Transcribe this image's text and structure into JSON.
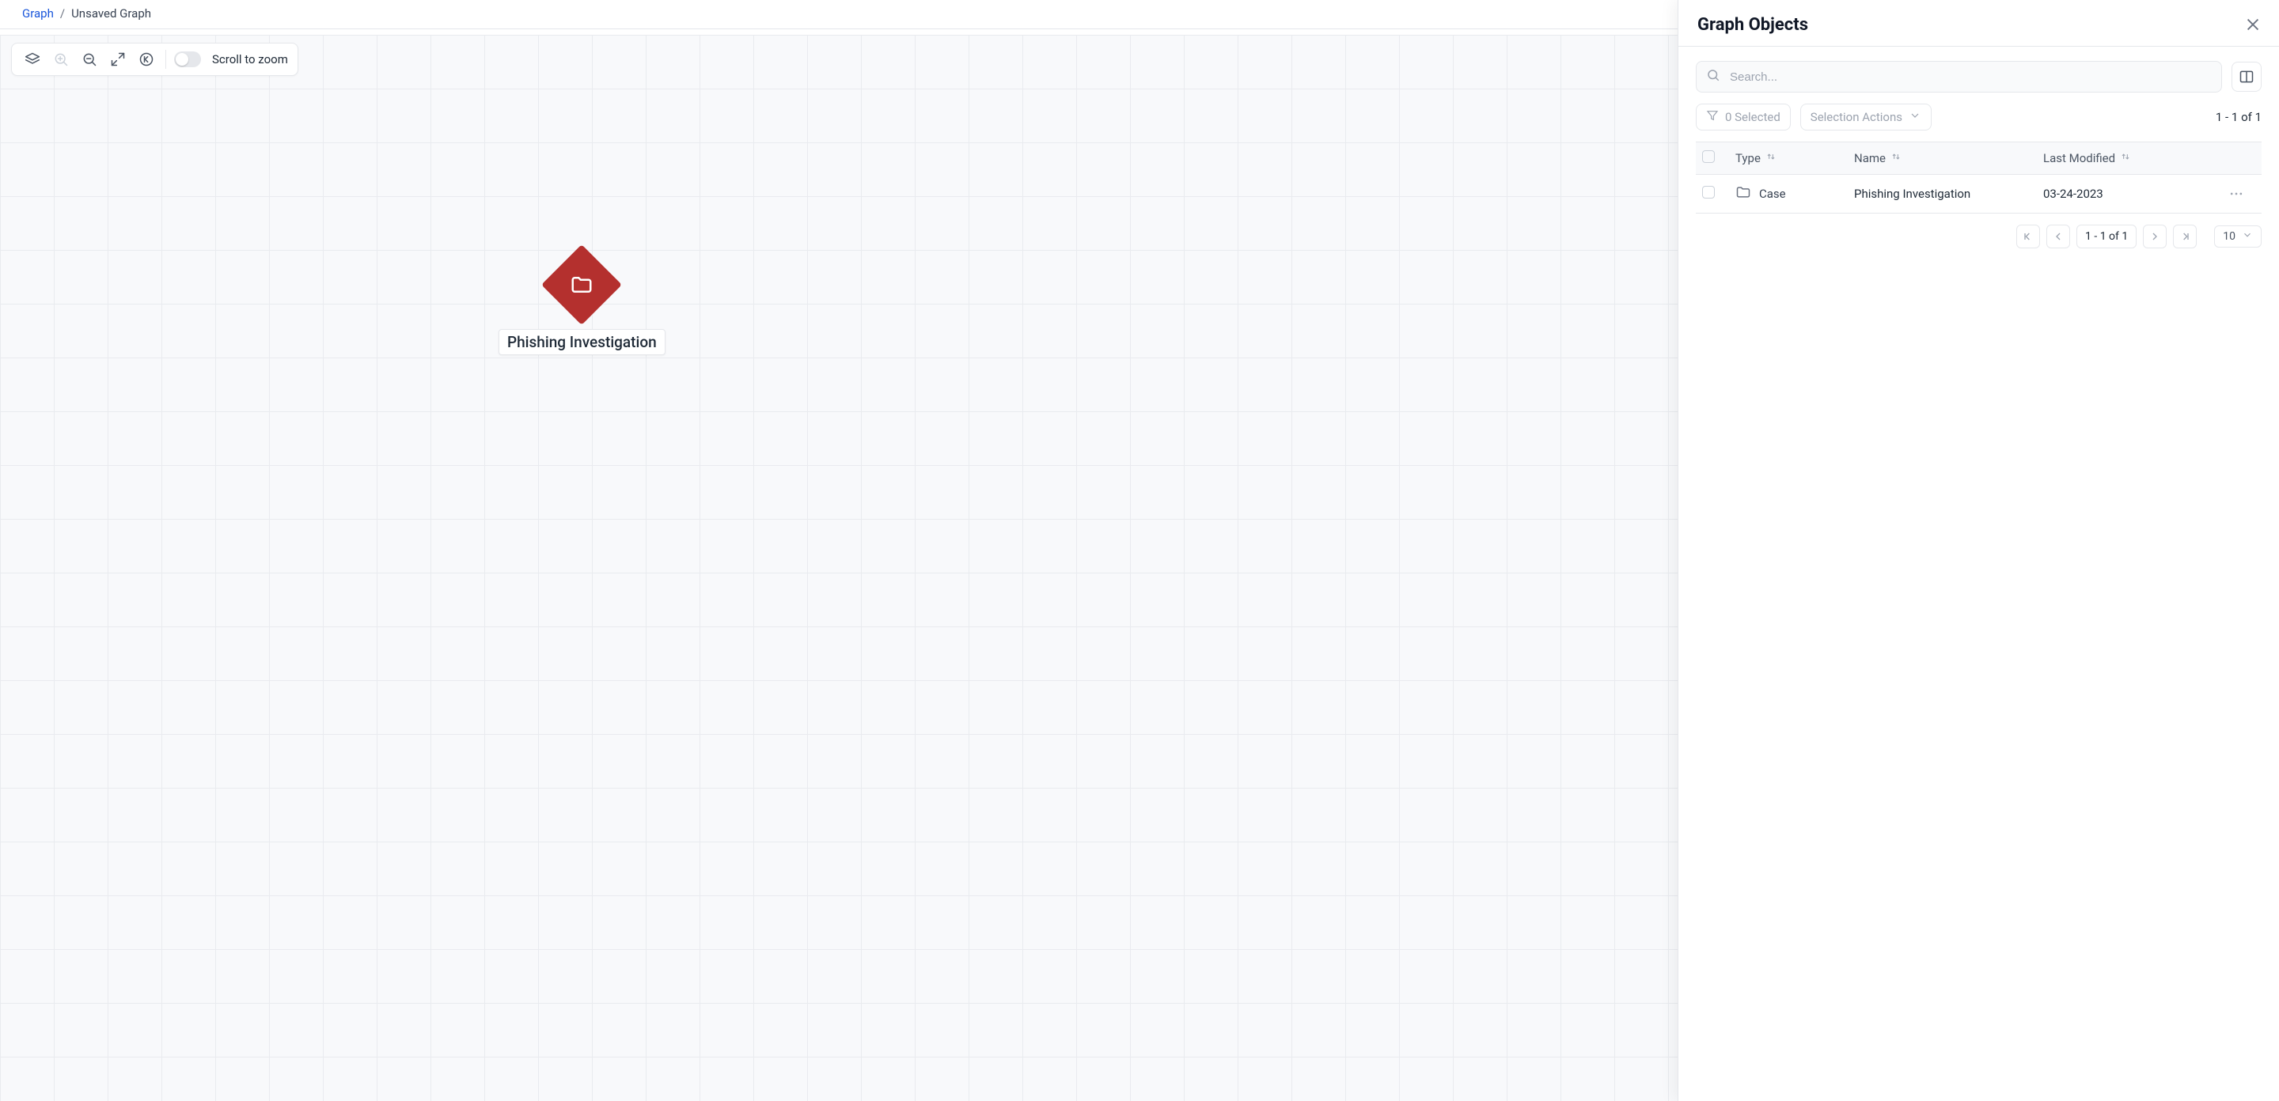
{
  "breadcrumbs": {
    "root": "Graph",
    "separator": "/",
    "current": "Unsaved Graph"
  },
  "toolbar": {
    "toggle_label": "Scroll to zoom"
  },
  "node": {
    "label": "Phishing Investigation"
  },
  "panel": {
    "title": "Graph Objects",
    "search_placeholder": "Search...",
    "selected_label": "0 Selected",
    "actions_label": "Selection Actions",
    "count_text": "1 - 1 of 1",
    "columns": {
      "type": "Type",
      "name": "Name",
      "last_modified": "Last Modified"
    },
    "rows": [
      {
        "type": "Case",
        "name": "Phishing Investigation",
        "last_modified": "03-24-2023"
      }
    ],
    "pagination": {
      "range": "1 - 1 of 1",
      "page_size": "10"
    }
  }
}
